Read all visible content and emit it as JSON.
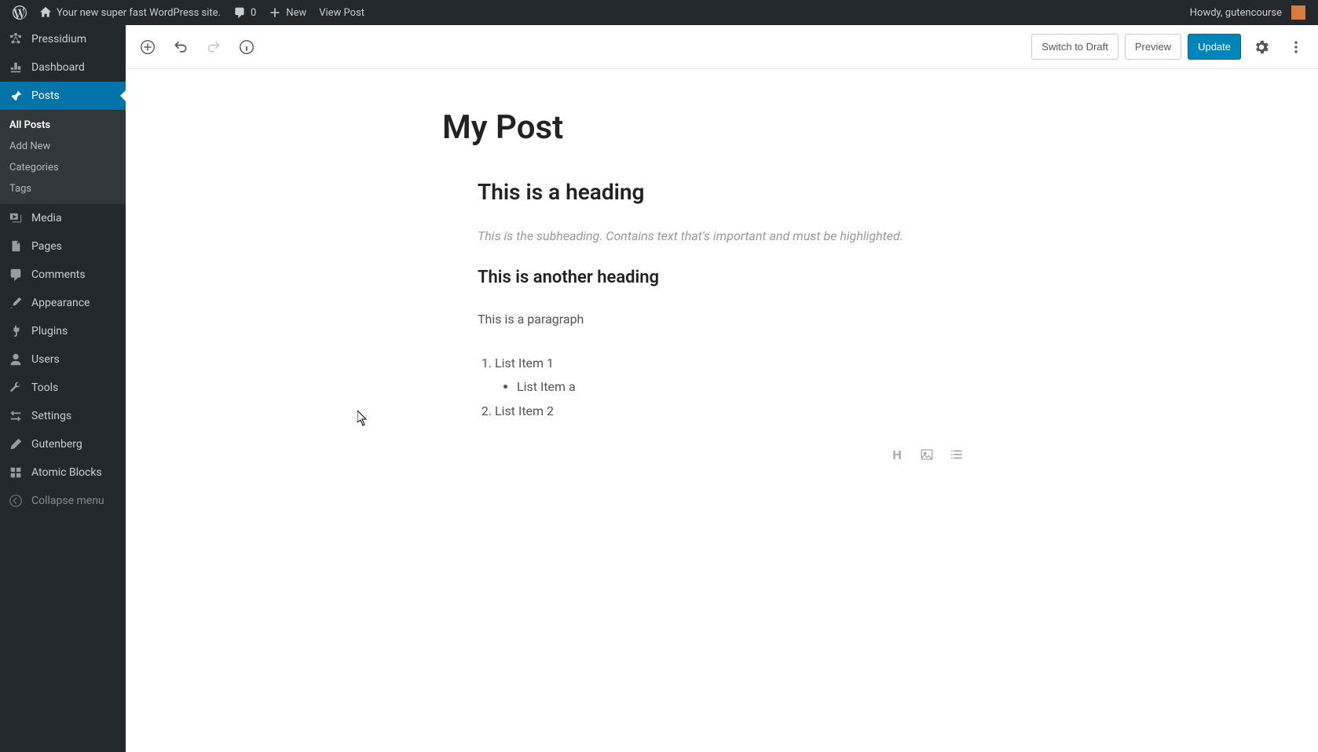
{
  "adminbar": {
    "site_tagline": "Your new super fast WordPress site.",
    "comments_count": "0",
    "new_label": "New",
    "view_post": "View Post",
    "howdy": "Howdy, gutencourse"
  },
  "sidebar": {
    "brand": "Pressidium",
    "items": [
      {
        "label": "Dashboard"
      },
      {
        "label": "Posts"
      },
      {
        "label": "Media"
      },
      {
        "label": "Pages"
      },
      {
        "label": "Comments"
      },
      {
        "label": "Appearance"
      },
      {
        "label": "Plugins"
      },
      {
        "label": "Users"
      },
      {
        "label": "Tools"
      },
      {
        "label": "Settings"
      },
      {
        "label": "Gutenberg"
      },
      {
        "label": "Atomic Blocks"
      }
    ],
    "submenu": [
      {
        "label": "All Posts"
      },
      {
        "label": "Add New"
      },
      {
        "label": "Categories"
      },
      {
        "label": "Tags"
      }
    ],
    "collapse": "Collapse menu"
  },
  "toolbar": {
    "switch_draft": "Switch to Draft",
    "preview": "Preview",
    "update": "Update"
  },
  "post": {
    "title": "My Post",
    "heading1": "This is a heading",
    "subheading": "This is the subheading. Contains text that's important and must be highlighted.",
    "heading2": "This is another heading",
    "paragraph": "This is a paragraph",
    "list": {
      "item1": "List Item 1",
      "item1a": "List Item a",
      "item2": "List Item 2"
    }
  }
}
